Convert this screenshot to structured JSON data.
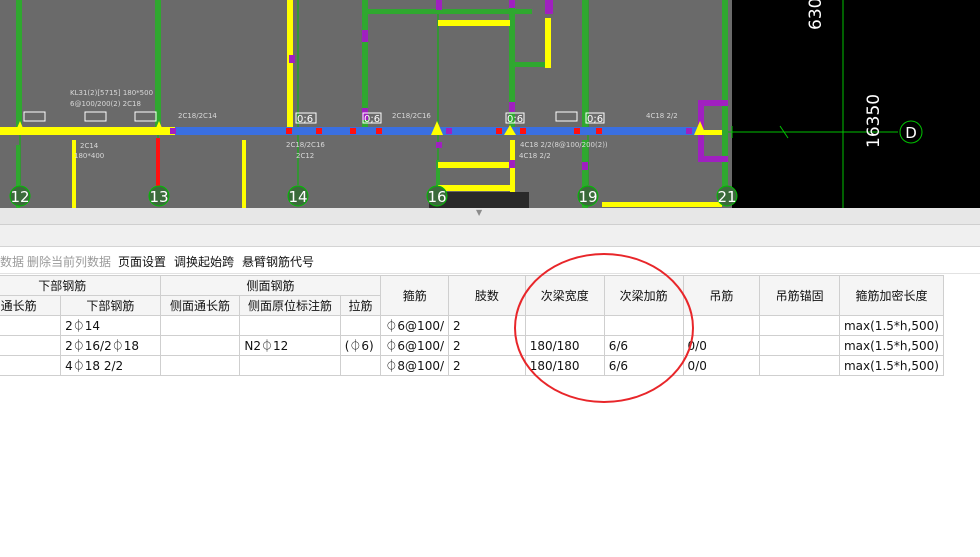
{
  "cad": {
    "background": "#6a6a6a",
    "axes": [
      "12",
      "13",
      "14",
      "16",
      "19",
      "21"
    ],
    "right_axis_label": "D",
    "dimensions": [
      "630",
      "16350"
    ],
    "span_labels": [
      "0;6",
      "0;6",
      "0;6",
      "0;6"
    ],
    "beam_texts": [
      "KL31(2)[5715] 180*500",
      "6@100/200(2) 2C18",
      "2C18/2C14",
      "2C14",
      "180*400",
      "2C18/2C16",
      "2C18/2C16",
      "2C12",
      "4C18 2/2",
      "4C18 2/2(8@100/200(2))",
      "4C18 2/2"
    ]
  },
  "toolbar": {
    "items": [
      {
        "label": "数据",
        "enabled": false
      },
      {
        "label": "删除当前列数据",
        "enabled": false
      },
      {
        "label": "页面设置",
        "enabled": true
      },
      {
        "label": "调换起始跨",
        "enabled": true
      },
      {
        "label": "悬臂钢筋代号",
        "enabled": true
      }
    ]
  },
  "table": {
    "group_headers": {
      "bottom": "下部钢筋",
      "side": "侧面钢筋"
    },
    "columns": {
      "bottom_through": "下通长筋",
      "bottom": "下部钢筋",
      "side_through": "侧面通长筋",
      "side_original": "侧面原位标注筋",
      "tie": "拉筋",
      "stirrup": "箍筋",
      "legs": "肢数",
      "sec_width": "次梁宽度",
      "sec_add": "次梁加筋",
      "hanger": "吊筋",
      "hanger_anchor": "吊筋锚固",
      "dense_len": "箍筋加密长度"
    },
    "rows": [
      {
        "bottom_through": "",
        "bottom": "2⏀14",
        "side_through": "",
        "side_original": "",
        "tie": "",
        "stirrup": "⏀6@100/",
        "legs": "2",
        "sec_width": "",
        "sec_add": "",
        "hanger": "",
        "hanger_anchor": "",
        "dense_len": "max(1.5*h,500)"
      },
      {
        "bottom_through": "",
        "bottom": "2⏀16/2⏀18",
        "side_through": "",
        "side_original": "N2⏀12",
        "tie": "(⏀6)",
        "stirrup": "⏀6@100/",
        "legs": "2",
        "sec_width": "180/180",
        "sec_add": "6/6",
        "hanger": "0/0",
        "hanger_anchor": "",
        "dense_len": "max(1.5*h,500)"
      },
      {
        "bottom_through": "",
        "bottom": "4⏀18 2/2",
        "side_through": "",
        "side_original": "",
        "tie": "",
        "stirrup": "⏀8@100/",
        "legs": "2",
        "sec_width": "180/180",
        "sec_add": "6/6",
        "hanger": "0/0",
        "hanger_anchor": "",
        "dense_len": "max(1.5*h,500)"
      }
    ]
  },
  "annotation_color": "#e8262a"
}
